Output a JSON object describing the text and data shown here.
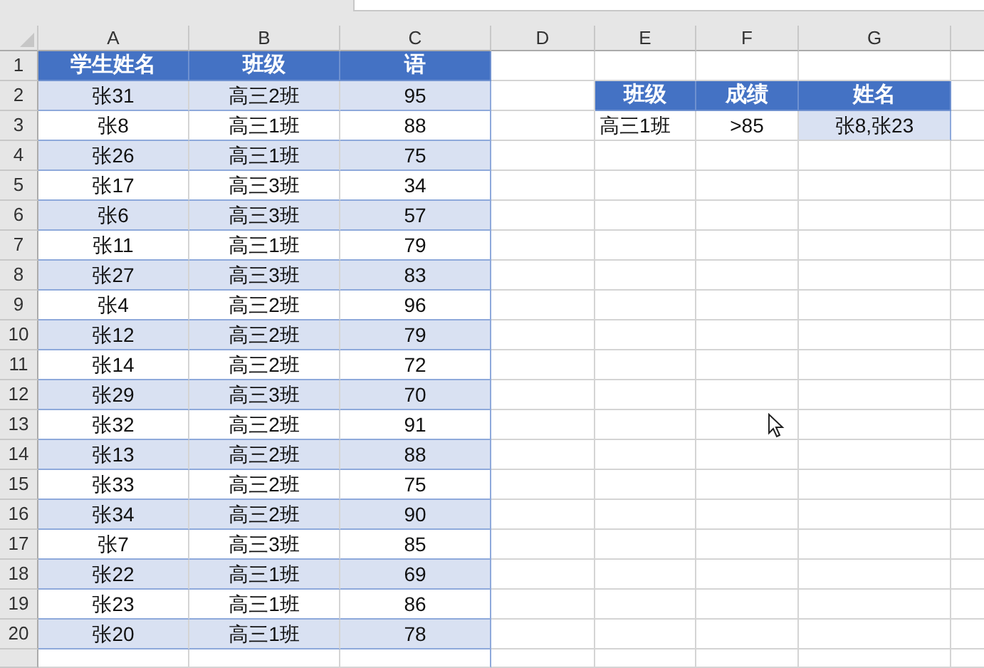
{
  "columns": [
    "A",
    "B",
    "C",
    "D",
    "E",
    "F",
    "G"
  ],
  "row_numbers": [
    "1",
    "2",
    "3",
    "4",
    "5",
    "6",
    "7",
    "8",
    "9",
    "10",
    "11",
    "12",
    "13",
    "14",
    "15",
    "16",
    "17",
    "18",
    "19",
    "20"
  ],
  "student_table": {
    "headers": [
      "学生姓名",
      "班级",
      "语"
    ],
    "rows": [
      {
        "cells": [
          "张31",
          "高三2班",
          "95"
        ],
        "shaded": true
      },
      {
        "cells": [
          "张8",
          "高三1班",
          "88"
        ],
        "shaded": false
      },
      {
        "cells": [
          "张26",
          "高三1班",
          "75"
        ],
        "shaded": true
      },
      {
        "cells": [
          "张17",
          "高三3班",
          "34"
        ],
        "shaded": false
      },
      {
        "cells": [
          "张6",
          "高三3班",
          "57"
        ],
        "shaded": true
      },
      {
        "cells": [
          "张11",
          "高三1班",
          "79"
        ],
        "shaded": false
      },
      {
        "cells": [
          "张27",
          "高三3班",
          "83"
        ],
        "shaded": true
      },
      {
        "cells": [
          "张4",
          "高三2班",
          "96"
        ],
        "shaded": false
      },
      {
        "cells": [
          "张12",
          "高三2班",
          "79"
        ],
        "shaded": true
      },
      {
        "cells": [
          "张14",
          "高三2班",
          "72"
        ],
        "shaded": false
      },
      {
        "cells": [
          "张29",
          "高三3班",
          "70"
        ],
        "shaded": true
      },
      {
        "cells": [
          "张32",
          "高三2班",
          "91"
        ],
        "shaded": false
      },
      {
        "cells": [
          "张13",
          "高三2班",
          "88"
        ],
        "shaded": true
      },
      {
        "cells": [
          "张33",
          "高三2班",
          "75"
        ],
        "shaded": false
      },
      {
        "cells": [
          "张34",
          "高三2班",
          "90"
        ],
        "shaded": true
      },
      {
        "cells": [
          "张7",
          "高三3班",
          "85"
        ],
        "shaded": false
      },
      {
        "cells": [
          "张22",
          "高三1班",
          "69"
        ],
        "shaded": true
      },
      {
        "cells": [
          "张23",
          "高三1班",
          "86"
        ],
        "shaded": false
      },
      {
        "cells": [
          "张20",
          "高三1班",
          "78"
        ],
        "shaded": true
      }
    ]
  },
  "lookup_table": {
    "headers": [
      "班级",
      "成绩",
      "姓名"
    ],
    "rows": [
      {
        "cells": [
          {
            "text": "高三1班",
            "shaded": false
          },
          {
            "text": ">85",
            "shaded": false
          },
          {
            "text": "张8,张23",
            "shaded": true
          }
        ]
      }
    ]
  }
}
